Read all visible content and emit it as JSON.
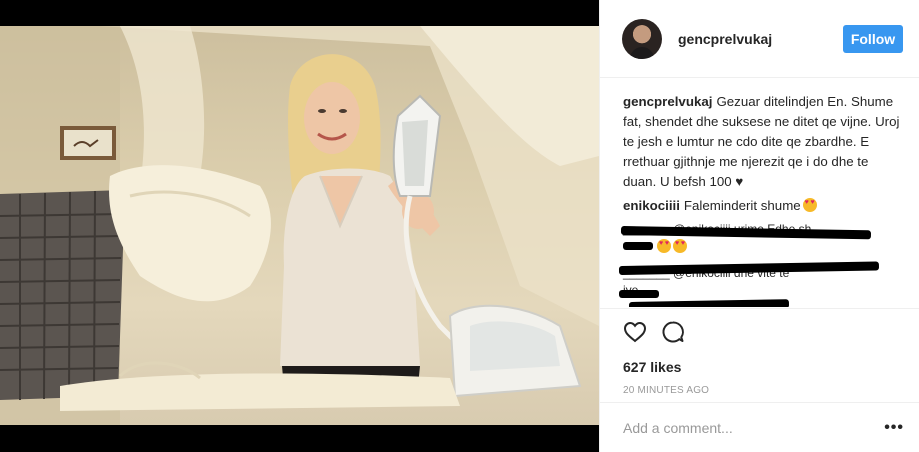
{
  "post": {
    "image_alt": "Woman holding an iron next to a laundry basket"
  },
  "header": {
    "username": "gencprelvukaj",
    "follow_label": "Follow"
  },
  "caption": {
    "username": "gencprelvukaj",
    "text": "Gezuar ditelindjen En. Shume fat, shendet dhe suksese ne ditet qe vijne. Uroj te jesh e lumtur ne cdo dite qe zbardhe. E rrethuar gjithnje me njerezit qe i do dhe te duan. U befsh 100",
    "heart": "♥"
  },
  "comments": [
    {
      "username": "enikociiii",
      "text": "Faleminderit shume"
    }
  ],
  "redacted": {
    "line1": "_______ @enikociiii urime Edhe sh",
    "line2": "_______ @enikociiii dhe  vite te",
    "line3": "jye"
  },
  "actions": {
    "likes": "627 likes",
    "time": "20 MINUTES AGO"
  },
  "add_comment": {
    "placeholder": "Add a comment...",
    "more": "•••"
  }
}
